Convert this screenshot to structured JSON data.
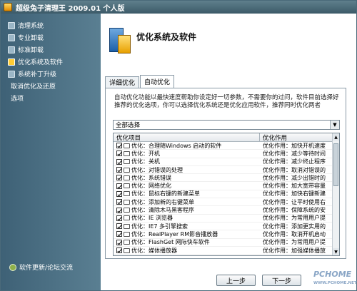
{
  "window": {
    "title": "超级兔子清理王 2009.01 个人版"
  },
  "sidebar": {
    "items": [
      {
        "label": "清理系统",
        "icon": "clean-icon"
      },
      {
        "label": "专业卸载",
        "icon": "uninstall-icon"
      },
      {
        "label": "标准卸载",
        "icon": "standard-uninstall-icon"
      },
      {
        "label": "优化系统及软件",
        "icon": "optimize-icon"
      },
      {
        "label": "系统补丁升级",
        "icon": "patch-icon"
      },
      {
        "label": "取消优化及还原",
        "icon": ""
      },
      {
        "label": "选项",
        "icon": ""
      }
    ],
    "footer": "软件更新/论坛交流"
  },
  "header": {
    "title": "优化系统及软件"
  },
  "tabs": [
    {
      "label": "详细优化"
    },
    {
      "label": "自动优化"
    }
  ],
  "panel": {
    "description": "自动优化功能以最快速度帮助你设定好一切参数，不需要你的过问，软件目前选择好推荐的优化选项，你可以选择优化系统还是优化应用软件，推荐同时优化两者",
    "select_value": "全部选择",
    "list": {
      "columns": [
        "优化项目",
        "优化作用"
      ],
      "rows": [
        [
          "优化：合理随Windows 启动的软件",
          "优化作用：加快开机速度"
        ],
        [
          "优化：开机",
          "优化作用：减少等待时间"
        ],
        [
          "优化：关机",
          "优化作用：减少终止程序"
        ],
        [
          "优化：对错误的处理",
          "优化作用：取消对错误的"
        ],
        [
          "优化：系统错误",
          "优化作用：减少出错时的"
        ],
        [
          "优化：网络优化",
          "优化作用：加大宽带容量"
        ],
        [
          "优化：鼠标右键的新建菜单",
          "优化作用：加快右键新建"
        ],
        [
          "优化：添加新的右键菜单",
          "优化作用：让平时使用右"
        ],
        [
          "优化：清除木马黑客程序",
          "优化作用：保障系统的安"
        ],
        [
          "优化：IE 浏览器",
          "优化作用：为常用用户提"
        ],
        [
          "优化：IE7 多引擎搜索",
          "优化作用：添加更实用的"
        ],
        [
          "优化：RealPlayer RM影音播放器",
          "优化作用：取消开机启动"
        ],
        [
          "优化：FlashGet 网际快车软件",
          "优化作用：为常用用户提"
        ],
        [
          "优化：媒体播放器",
          "优化作用：加强媒体播放"
        ]
      ]
    }
  },
  "buttons": {
    "prev": "上一步",
    "next": "下一步"
  },
  "watermark": {
    "brand": "PCHOME",
    "url": "WWW.PCHOME.NET"
  }
}
